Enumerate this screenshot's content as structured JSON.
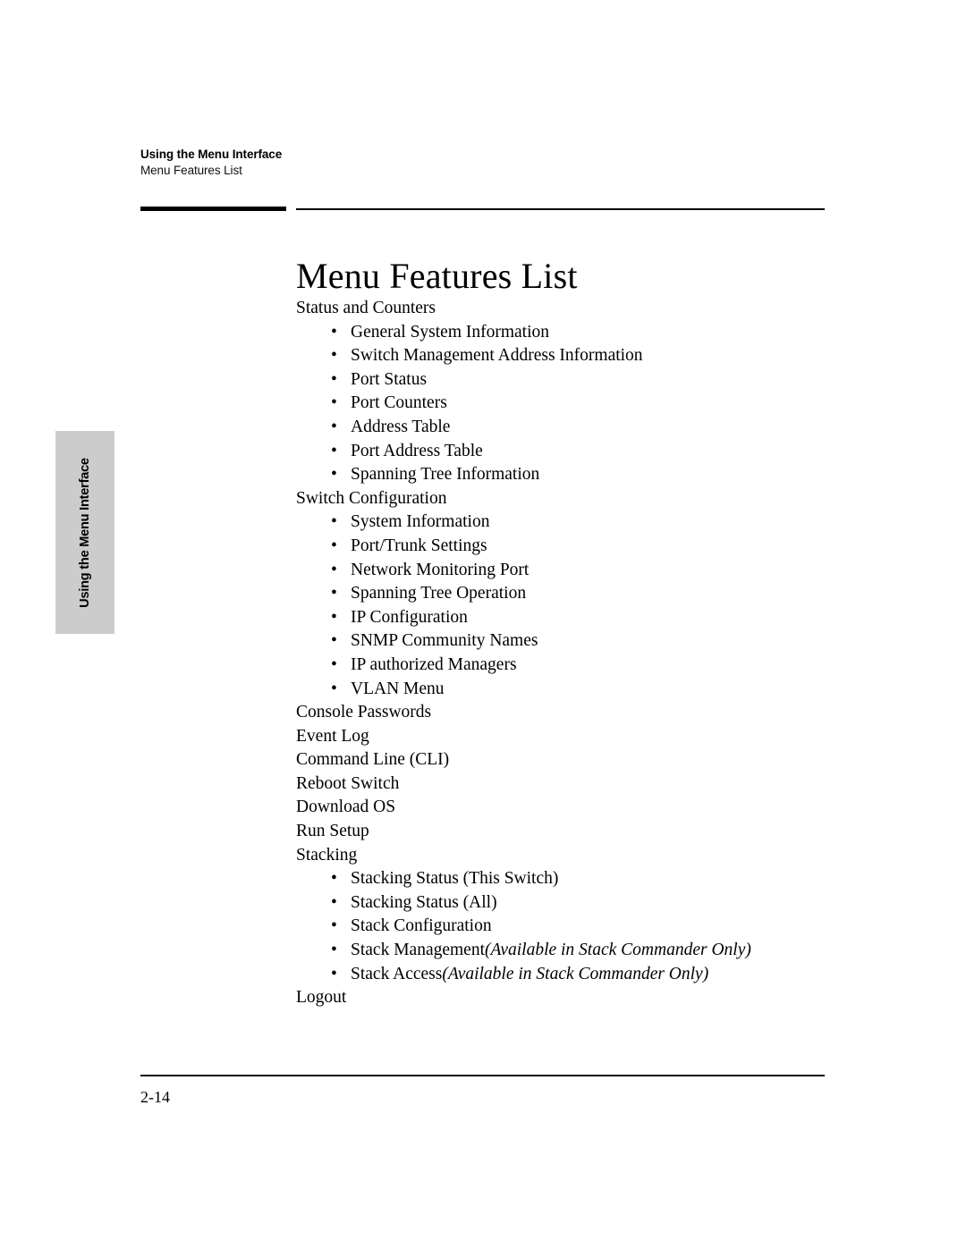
{
  "header": {
    "chapter_title": "Using the Menu Interface",
    "section_title": "Menu Features List"
  },
  "side_tab": {
    "label": "Using the Menu Interface",
    "background_color": "#cccccc"
  },
  "page": {
    "title": "Menu Features List",
    "page_number": "2-14"
  },
  "feature_list": [
    {
      "level": 0,
      "text": "Status and Counters"
    },
    {
      "level": 1,
      "bullet": "•",
      "text": "General System Information"
    },
    {
      "level": 1,
      "bullet": "•",
      "text": "Switch Management Address Information"
    },
    {
      "level": 1,
      "bullet": "•",
      "text": "Port Status"
    },
    {
      "level": 1,
      "bullet": "•",
      "text": "Port Counters"
    },
    {
      "level": 1,
      "bullet": "•",
      "text": "Address Table"
    },
    {
      "level": 1,
      "bullet": "•",
      "text": "Port Address Table"
    },
    {
      "level": 1,
      "bullet": "•",
      "text": "Spanning Tree Information"
    },
    {
      "level": 0,
      "text": "Switch Configuration"
    },
    {
      "level": 1,
      "bullet": "•",
      "text": "System Information"
    },
    {
      "level": 1,
      "bullet": "•",
      "text": "Port/Trunk Settings"
    },
    {
      "level": 1,
      "bullet": "•",
      "text": "Network Monitoring Port"
    },
    {
      "level": 1,
      "bullet": "•",
      "text": "Spanning Tree Operation"
    },
    {
      "level": 1,
      "bullet": "•",
      "text": "IP Configuration"
    },
    {
      "level": 1,
      "bullet": "•",
      "text": "SNMP Community Names"
    },
    {
      "level": 1,
      "bullet": "•",
      "text": "IP authorized Managers"
    },
    {
      "level": 1,
      "bullet": "•",
      "text": "VLAN Menu"
    },
    {
      "level": 0,
      "text": "Console Passwords"
    },
    {
      "level": 0,
      "text": "Event Log"
    },
    {
      "level": 0,
      "text": "Command Line (CLI)"
    },
    {
      "level": 0,
      "text": "Reboot Switch"
    },
    {
      "level": 0,
      "text": "Download OS"
    },
    {
      "level": 0,
      "text": "Run Setup"
    },
    {
      "level": 0,
      "text": "Stacking"
    },
    {
      "level": 1,
      "bullet": "•",
      "text": "Stacking Status (This Switch)"
    },
    {
      "level": 1,
      "bullet": "•",
      "text": "Stacking Status (All)"
    },
    {
      "level": 1,
      "bullet": "•",
      "text": "Stack Configuration"
    },
    {
      "level": 1,
      "bullet": "•",
      "text": "Stack Management ",
      "note": "(Available in Stack Commander Only)"
    },
    {
      "level": 1,
      "bullet": "•",
      "text": "Stack Access ",
      "note": "(Available in Stack Commander Only)"
    },
    {
      "level": 0,
      "text": "Logout"
    }
  ]
}
